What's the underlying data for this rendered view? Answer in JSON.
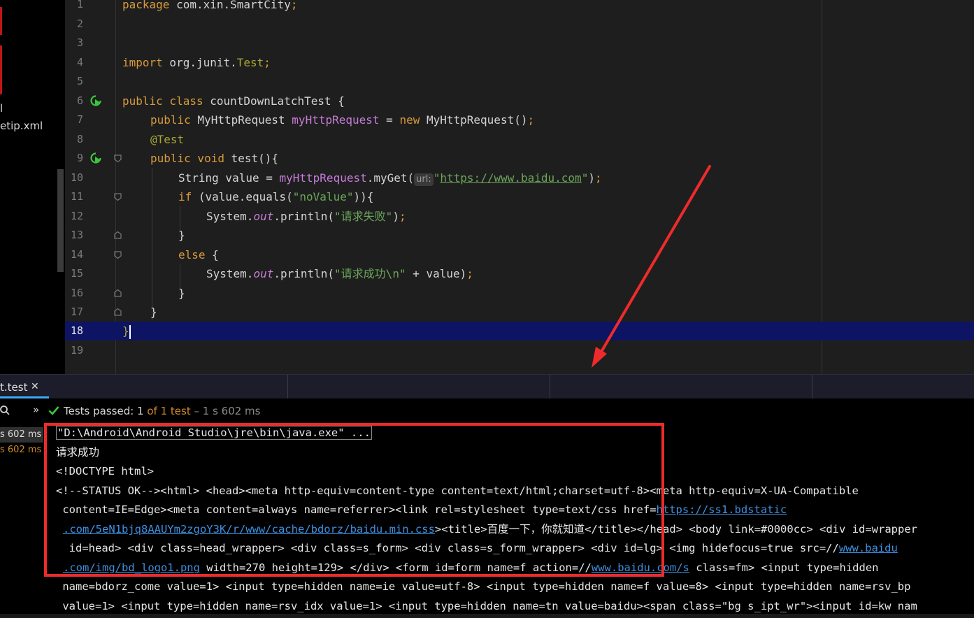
{
  "project_panel": {
    "items": [
      "l",
      "etip.xml"
    ]
  },
  "editor": {
    "lines": [
      {
        "n": "1"
      },
      {
        "n": "2"
      },
      {
        "n": "3"
      },
      {
        "n": "4"
      },
      {
        "n": "5"
      },
      {
        "n": "6"
      },
      {
        "n": "7"
      },
      {
        "n": "8"
      },
      {
        "n": "9"
      },
      {
        "n": "10"
      },
      {
        "n": "11"
      },
      {
        "n": "12"
      },
      {
        "n": "13"
      },
      {
        "n": "14"
      },
      {
        "n": "15"
      },
      {
        "n": "16"
      },
      {
        "n": "17"
      },
      {
        "n": "18"
      },
      {
        "n": "19"
      }
    ],
    "code": {
      "l1_kw": "package",
      "l1_pkg": " com.xin.SmartCity",
      "l1_semi": ";",
      "l4_kw": "import",
      "l4_pkg": " org.junit.",
      "l4_cls": "Test",
      "l4_semi": ";",
      "l6_kw": "public class",
      "l6_name": " countDownLatchTest {",
      "l7_kw": "public",
      "l7_type": " MyHttpRequest ",
      "l7_field": "myHttpRequest",
      "l7_eq": " = ",
      "l7_new": "new",
      "l7_rest": " MyHttpRequest()",
      "l7_semi": ";",
      "l8_ann": "@Test",
      "l9_kw": "public void",
      "l9_rest": " test(){",
      "l10_type": "String value = ",
      "l10_field": "myHttpRequest",
      "l10_call": ".myGet(",
      "l10_hint": "url:",
      "l10_q1": "\"",
      "l10_url": "https://www.baidu.com",
      "l10_q2": "\"",
      "l10_end": ")",
      "l10_semi": ";",
      "l11_kw": "if",
      "l11_rest1": " (value.equals(",
      "l11_str": "\"noValue\"",
      "l11_rest2": ")){",
      "l12_sys": "System.",
      "l12_out": "out",
      "l12_call": ".println(",
      "l12_str": "\"请求失败\"",
      "l12_end": ")",
      "l12_semi": ";",
      "l13": "}",
      "l14_kw": "else",
      "l14_rest": " {",
      "l15_sys": "System.",
      "l15_out": "out",
      "l15_call": ".println(",
      "l15_str": "\"请求成功\\n\"",
      "l15_rest": " + value)",
      "l15_semi": ";",
      "l16": "}",
      "l17": "}",
      "l18": "}"
    }
  },
  "tool_window": {
    "tab_label": "t.test",
    "tab_close": "✕",
    "status_prefix": "Tests passed: ",
    "status_passed": "1",
    "status_of": " of 1 test",
    "status_time": " – 1 s 602 ms",
    "chevron": "»",
    "tree": [
      "s 602 ms",
      "s 602 ms"
    ]
  },
  "console": {
    "cmd": "\"D:\\Android\\Android Studio\\jre\\bin\\java.exe\" ...",
    "line2": "请求成功",
    "line3": "<!DOCTYPE html>",
    "line4": "<!--STATUS OK--><html> <head><meta http-equiv=content-type content=text/html;charset=utf-8><meta http-equiv=X-UA-Compatible",
    "line5_a": " content=IE=Edge><meta content=always name=referrer><link rel=stylesheet type=text/css href=",
    "line5_link": "https://ss1.bdstatic",
    "line6_link": ".com/5eN1bjq8AAUYm2zgoY3K/r/www/cache/bdorz/baidu.min.css",
    "line6_b": "><title>百度一下，你就知道</title></head> <body link=#0000cc> <div id=wrapper",
    "line7_a": "  id=head> <div class=head_wrapper> <div class=s_form> <div class=s_form_wrapper> <div id=lg> <img hidefocus=true src=//",
    "line7_link": "www.baidu",
    "line8_link": ".com/img/bd_logo1.png",
    "line8_b": " width=270 height=129> </div> <form id=form name=f action=//",
    "line8_link2": "www.baidu.com/s",
    "line8_c": " class=fm> <input type=hidden",
    "line9": " name=bdorz_come value=1> <input type=hidden name=ie value=utf-8> <input type=hidden name=f value=8> <input type=hidden name=rsv_bp",
    "line10": " value=1> <input type=hidden name=rsv_idx value=1> <input type=hidden name=tn value=baidu><span class=\"bg s_ipt_wr\"><input id=kw nam"
  },
  "colors": {
    "annotation_red": "#ee2b2b",
    "keyword": "#d89b3c",
    "string": "#6ba55a",
    "field": "#c77dd8",
    "link": "#3d8fe0",
    "current_line": "#0d1463"
  }
}
